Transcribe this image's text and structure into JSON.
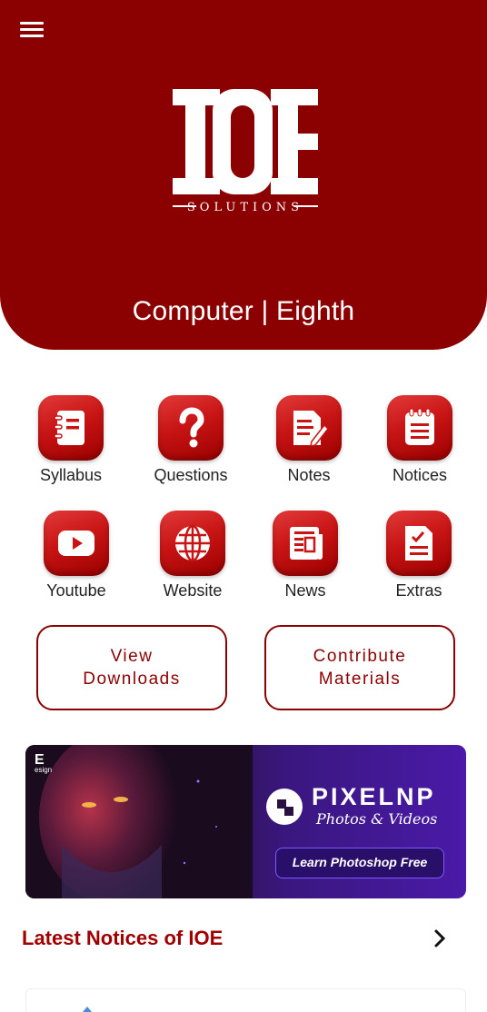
{
  "header": {
    "logo_text": "IOE SOLUTIONS",
    "course_title": "Computer | Eighth"
  },
  "grid": [
    {
      "label": "Syllabus",
      "icon": "notebook-icon"
    },
    {
      "label": "Questions",
      "icon": "question-mark-icon"
    },
    {
      "label": "Notes",
      "icon": "edit-note-icon"
    },
    {
      "label": "Notices",
      "icon": "notepad-icon"
    },
    {
      "label": "Youtube",
      "icon": "youtube-icon"
    },
    {
      "label": "Website",
      "icon": "globe-icon"
    },
    {
      "label": "News",
      "icon": "newspaper-icon"
    },
    {
      "label": "Extras",
      "icon": "checklist-icon"
    }
  ],
  "buttons": {
    "view_downloads": "View\nDownloads",
    "contribute": "Contribute\nMaterials"
  },
  "banner": {
    "corner_logo": "E",
    "corner_logo_sub": "esign",
    "brand": "PIXELNP",
    "tagline": "Photos & Videos",
    "cta": "Learn Photoshop Free"
  },
  "notices": {
    "title": "Latest Notices of IOE"
  },
  "colors": {
    "primary": "#8b0000",
    "accent_red": "#c81414",
    "banner_purple": "#4a1aa8"
  }
}
